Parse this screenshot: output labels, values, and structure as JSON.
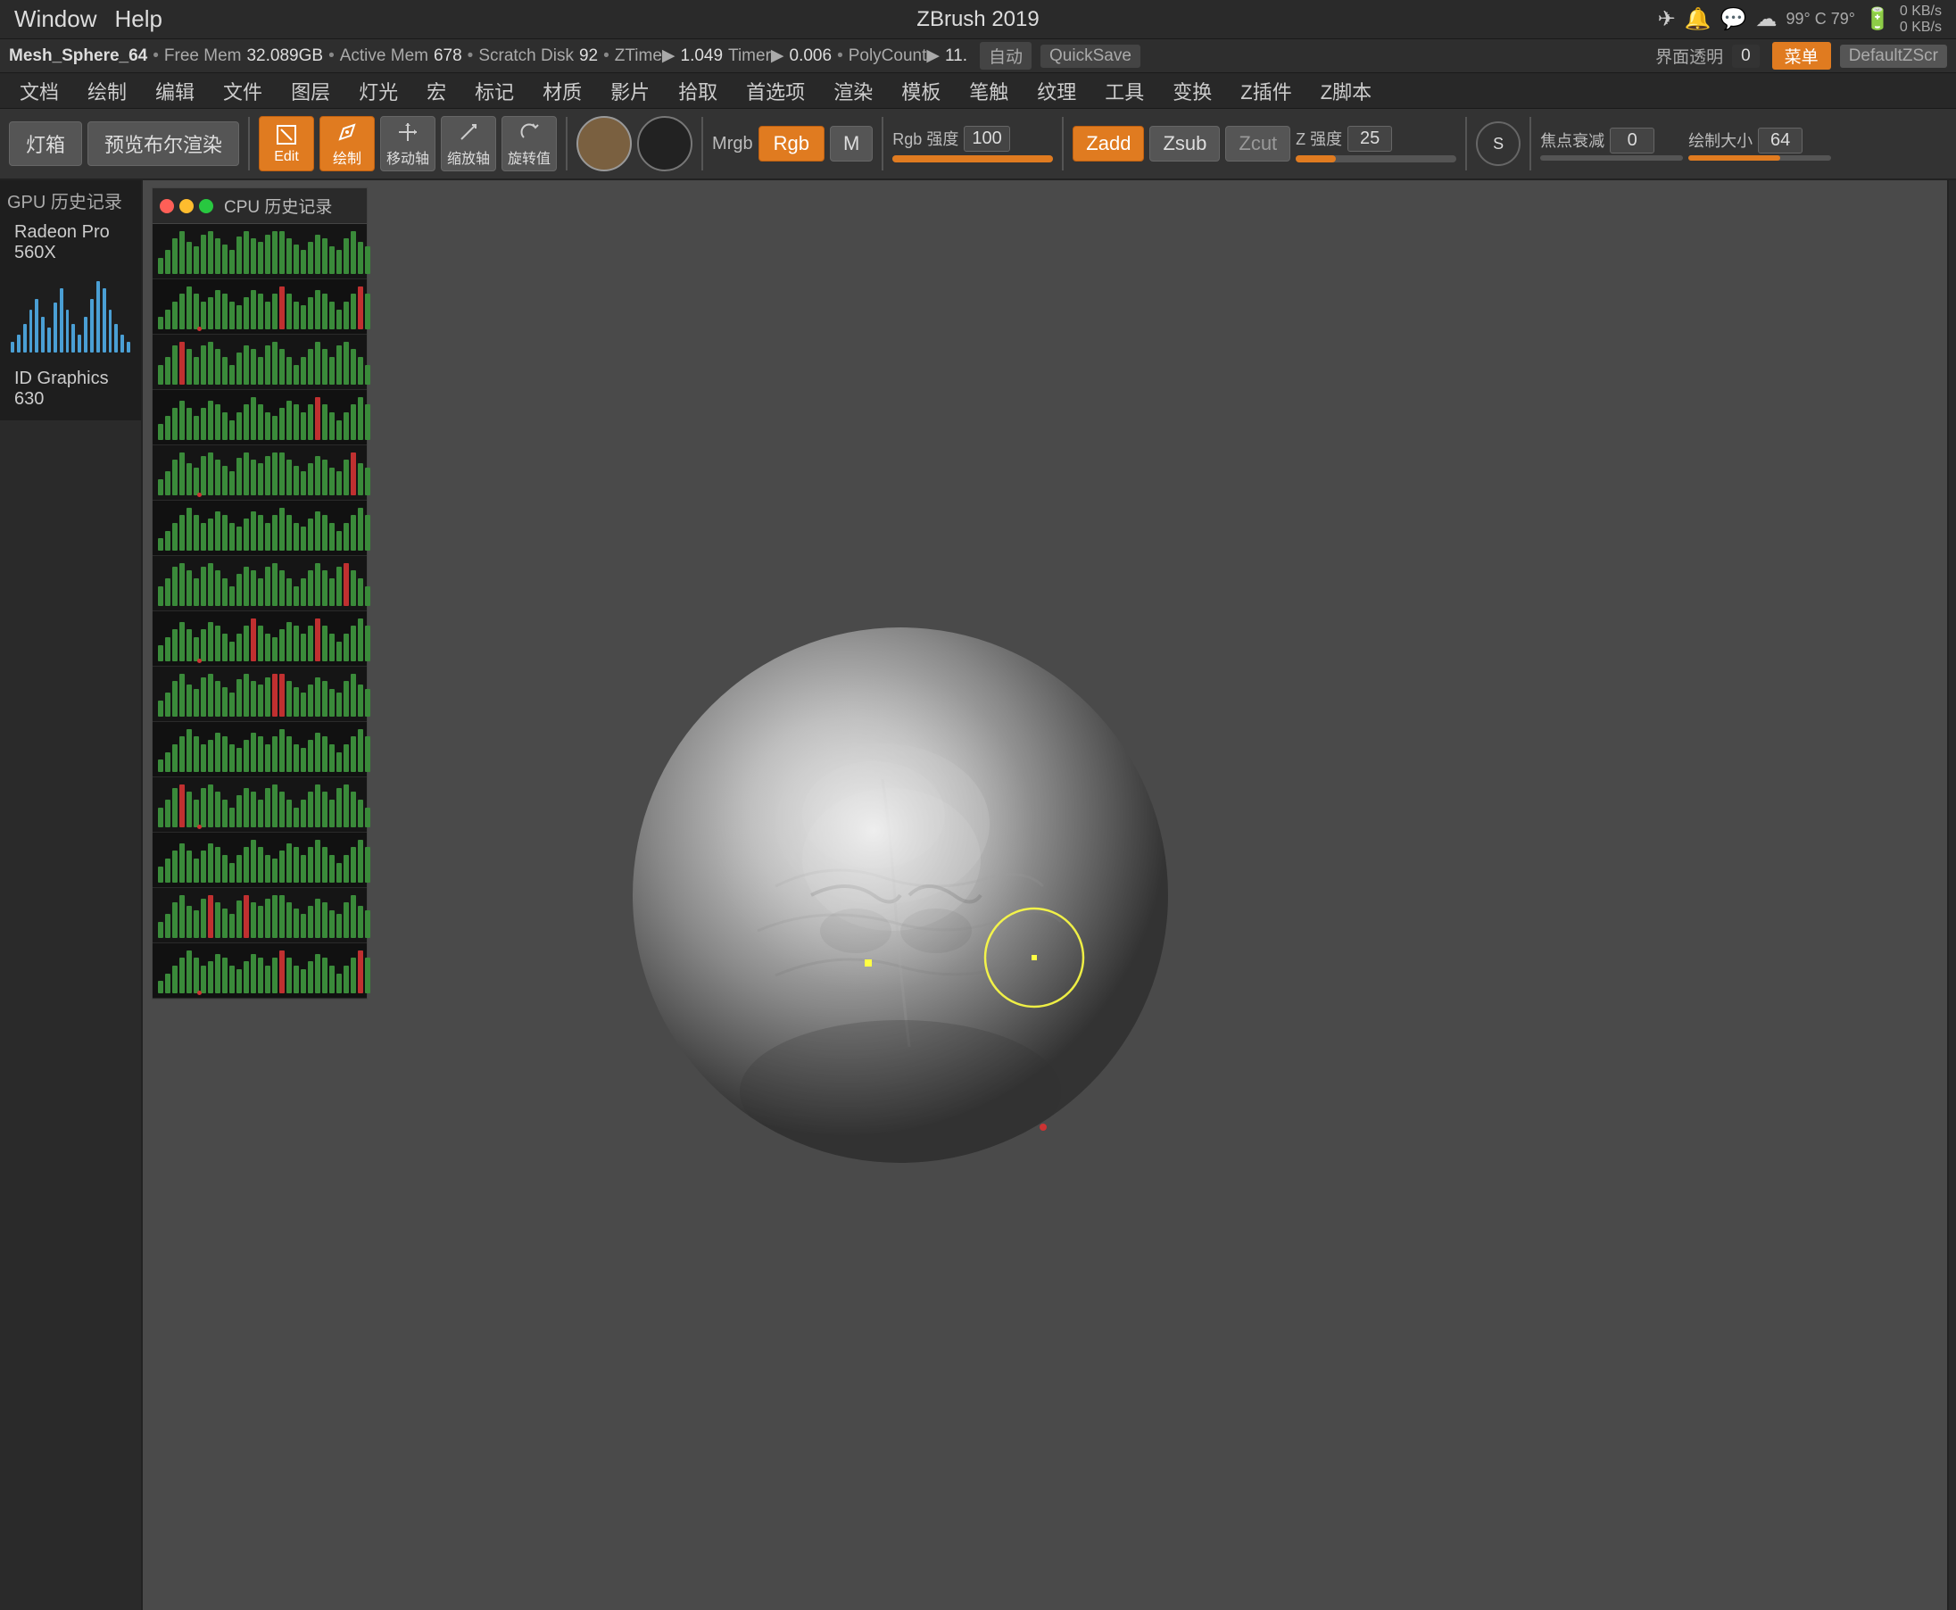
{
  "titlebar": {
    "left_menu": [
      "Window",
      "Help"
    ],
    "title": "ZBrush 2019",
    "right_icons": [
      "airplane",
      "bell",
      "wechat",
      "cloud"
    ],
    "stats": "99° C  79°",
    "network": "0 KB/s\n0 KB/s"
  },
  "statusbar": {
    "mesh_name": "Mesh_Sphere_64",
    "free_mem_label": "Free Mem",
    "free_mem_val": "32.089GB",
    "active_mem_label": "Active Mem",
    "active_mem_val": "678",
    "scratch_disk_label": "Scratch Disk",
    "scratch_disk_val": "92",
    "ztime_label": "ZTime▶",
    "ztime_val": "1.049",
    "timer_label": "Timer▶",
    "timer_val": "0.006",
    "polycount_label": "PolyCount▶",
    "polycount_val": "11.",
    "auto_label": "自动",
    "quicksave_label": "QuickSave",
    "interface_transp_label": "界面透明",
    "interface_transp_val": "0",
    "menu_label": "菜单",
    "defaultz_label": "DefaultZScr"
  },
  "menubar": {
    "items": [
      "文档",
      "绘制",
      "编辑",
      "文件",
      "图层",
      "灯光",
      "宏",
      "标记",
      "材质",
      "影片",
      "拾取",
      "首选项",
      "渲染",
      "模板",
      "笔触",
      "纹理",
      "工具",
      "变换",
      "Z插件",
      "Z脚本"
    ]
  },
  "toolbar": {
    "light_box_label": "灯箱",
    "preview_label": "预览布尔渲染",
    "edit_btn": "Edit",
    "draw_btn": "绘制",
    "move_btn": "移动轴",
    "scale_btn": "缩放轴",
    "rotate_btn": "旋转值",
    "mrgb_label": "Mrgb",
    "rgb_btn": "Rgb",
    "m_btn": "M",
    "rgb_strength_label": "Rgb 强度",
    "rgb_strength_val": "100",
    "zadd_btn": "Zadd",
    "zsub_btn": "Zsub",
    "zcut_btn": "Zcut",
    "z_strength_label": "Z 强度",
    "z_strength_val": "25",
    "focal_falloff_label": "焦点衰减",
    "focal_falloff_val": "0",
    "draw_size_label": "绘制大小",
    "draw_size_val": "64"
  },
  "gpu_panel": {
    "title": "GPU 历史记录",
    "gpu1_name": "Radeon Pro 560X",
    "gpu2_name": "ID Graphics 630",
    "bars": [
      3,
      5,
      8,
      12,
      15,
      10,
      7,
      14,
      18,
      12,
      8,
      5,
      10,
      15,
      20,
      18,
      12,
      8,
      5,
      3
    ]
  },
  "cpu_panel": {
    "title": "CPU 历史记录",
    "rows": 14
  },
  "canvas": {
    "sphere_present": true,
    "brush_cursor_visible": true
  }
}
